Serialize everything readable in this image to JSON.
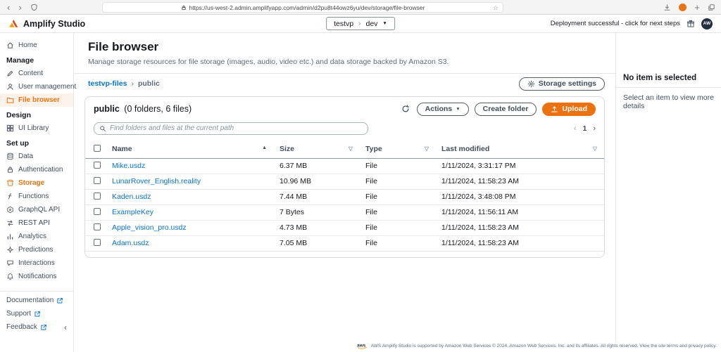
{
  "browser_chrome": {
    "url": "https://us-west-2.admin.amplifyapp.com/admin/d2pu8t44owz6yu/dev/storage/file-browser"
  },
  "app_header": {
    "app_name": "Amplify Studio",
    "environment": {
      "app": "testvp",
      "branch": "dev"
    },
    "deployment_status": "Deployment successful - click for next steps",
    "avatar_initials": "AW"
  },
  "sidebar": {
    "home_label": "Home",
    "sections": [
      {
        "label": "Manage",
        "items": [
          {
            "label": "Content"
          },
          {
            "label": "User management"
          },
          {
            "label": "File browser"
          }
        ]
      },
      {
        "label": "Design",
        "items": [
          {
            "label": "UI Library"
          }
        ]
      },
      {
        "label": "Set up",
        "items": [
          {
            "label": "Data"
          },
          {
            "label": "Authentication"
          },
          {
            "label": "Storage"
          },
          {
            "label": "Functions"
          },
          {
            "label": "GraphQL API"
          },
          {
            "label": "REST API"
          },
          {
            "label": "Analytics"
          },
          {
            "label": "Predictions"
          },
          {
            "label": "Interactions"
          },
          {
            "label": "Notifications"
          }
        ]
      }
    ],
    "footer_items": [
      {
        "label": "Documentation"
      },
      {
        "label": "Support"
      },
      {
        "label": "Feedback"
      }
    ]
  },
  "page": {
    "title": "File browser",
    "subtitle": "Manage storage resources for file storage (images, audio, video etc.) and data storage backed by Amazon S3.",
    "breadcrumb": {
      "root": "testvp-files",
      "current": "public"
    },
    "storage_settings_label": "Storage settings"
  },
  "file_panel": {
    "folder_name": "public",
    "folder_summary": "(0 folders, 6 files)",
    "actions_label": "Actions",
    "create_folder_label": "Create folder",
    "upload_label": "Upload",
    "search_placeholder": "Find folders and files at the current path",
    "pagination_current": "1"
  },
  "table": {
    "columns": [
      "Name",
      "Size",
      "Type",
      "Last modified"
    ],
    "rows": [
      {
        "name": "Mike.usdz",
        "size": "6.37 MB",
        "type": "File",
        "modified": "1/11/2024, 3:31:17 PM"
      },
      {
        "name": "LunarRover_English.reality",
        "size": "10.96 MB",
        "type": "File",
        "modified": "1/11/2024, 11:58:23 AM"
      },
      {
        "name": "Kaden.usdz",
        "size": "7.44 MB",
        "type": "File",
        "modified": "1/11/2024, 3:48:08 PM"
      },
      {
        "name": "ExampleKey",
        "size": "7 Bytes",
        "type": "File",
        "modified": "1/11/2024, 11:56:11 AM"
      },
      {
        "name": "Apple_vision_pro.usdz",
        "size": "4.73 MB",
        "type": "File",
        "modified": "1/11/2024, 11:58:23 AM"
      },
      {
        "name": "Adam.usdz",
        "size": "7.05 MB",
        "type": "File",
        "modified": "1/11/2024, 11:58:23 AM"
      }
    ]
  },
  "detail_panel": {
    "title": "No item is selected",
    "description": "Select an item to view more details"
  },
  "footer": {
    "text": "AWS Amplify Studio is supported by Amazon Web Services © 2024, Amazon Web Services, Inc. and its affiliates. All rights reserved. View the site terms and privacy policy."
  },
  "icons": {
    "sort_ascending": "▲",
    "column_sort": "▽",
    "caret_down": "▼",
    "chevron_left": "‹",
    "chevron_right": "›",
    "breadcrumb_separator": "›",
    "collapse_sidebar": "‹",
    "bookmark_star": "☆",
    "new_tab": "+",
    "back_arrow": "‹",
    "forward_arrow": "›"
  },
  "colors": {
    "accent_orange": "#ec7211",
    "link_blue": "#0972d3",
    "avatar_navy": "#232f3e"
  }
}
